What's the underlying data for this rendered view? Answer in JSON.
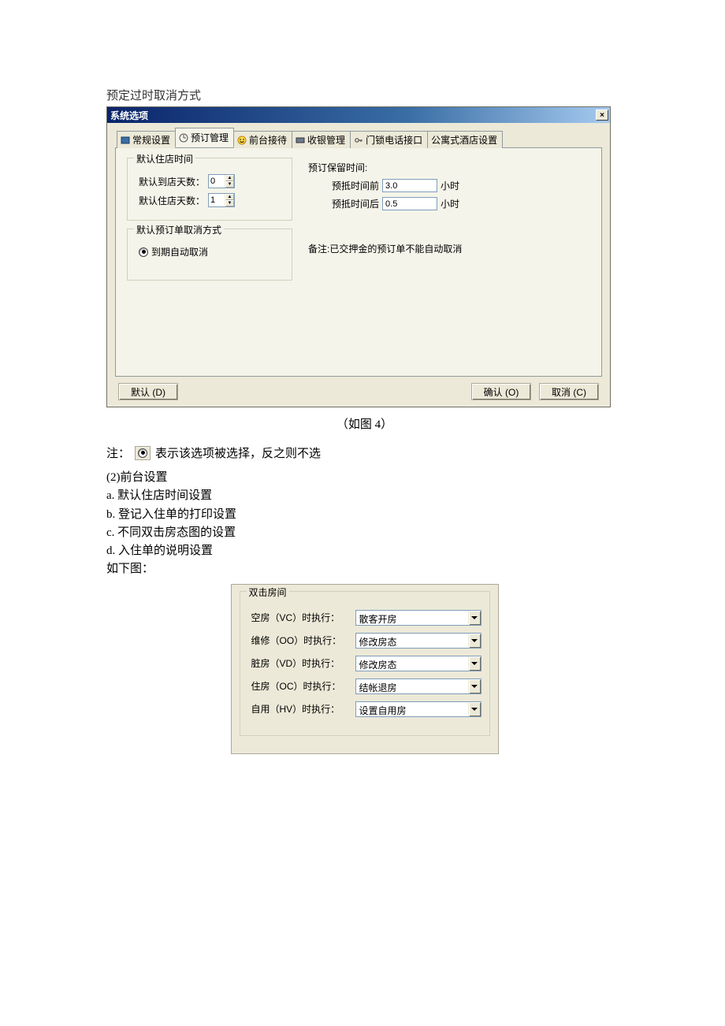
{
  "heading": "预定过时取消方式",
  "dialog": {
    "title": "系统选项",
    "close": "×",
    "tabs": [
      {
        "label": "常规设置",
        "icon": "general-icon"
      },
      {
        "label": "预订管理",
        "icon": "booking-icon"
      },
      {
        "label": "前台接待",
        "icon": "reception-icon"
      },
      {
        "label": "收银管理",
        "icon": "cashier-icon"
      },
      {
        "label": "门锁电话接口",
        "icon": "lock-icon"
      },
      {
        "label": "公寓式酒店设置",
        "icon": "apartment-icon"
      }
    ],
    "group_checkin": {
      "title": "默认住店时间",
      "arrive_label": "默认到店天数：",
      "arrive_value": "0",
      "stay_label": "默认住店天数：",
      "stay_value": "1"
    },
    "group_cancel": {
      "title": "默认预订单取消方式",
      "option1": "到期自动取消"
    },
    "reserve": {
      "title": "预订保留时间:",
      "before_label": "预抵时间前",
      "before_value": "3.0",
      "before_unit": "小时",
      "after_label": "预抵时间后",
      "after_value": "0.5",
      "after_unit": "小时"
    },
    "remark": "备注:已交押金的预订单不能自动取消",
    "buttons": {
      "default": "默认 (D)",
      "ok": "确认 (O)",
      "cancel": "取消 (C)"
    }
  },
  "figure_caption": "（如图 4）",
  "note": {
    "prefix": "注：",
    "suffix": "表示该选项被选择，反之则不选"
  },
  "section2": {
    "title": "(2)前台设置",
    "a": "a.  默认住店时间设置",
    "b": "b.  登记入住单的打印设置",
    "c": "c.  不同双击房态图的设置",
    "d": "d.  入住单的说明设置",
    "below": "如下图："
  },
  "panel2": {
    "title": "双击房间",
    "rows": [
      {
        "label": "空房（VC）时执行：",
        "value": "散客开房"
      },
      {
        "label": "维修（OO）时执行：",
        "value": "修改房态"
      },
      {
        "label": "脏房（VD）时执行：",
        "value": "修改房态"
      },
      {
        "label": "住房（OC）时执行：",
        "value": "结帐退房"
      },
      {
        "label": "自用（HV）时执行：",
        "value": "设置自用房"
      }
    ]
  }
}
